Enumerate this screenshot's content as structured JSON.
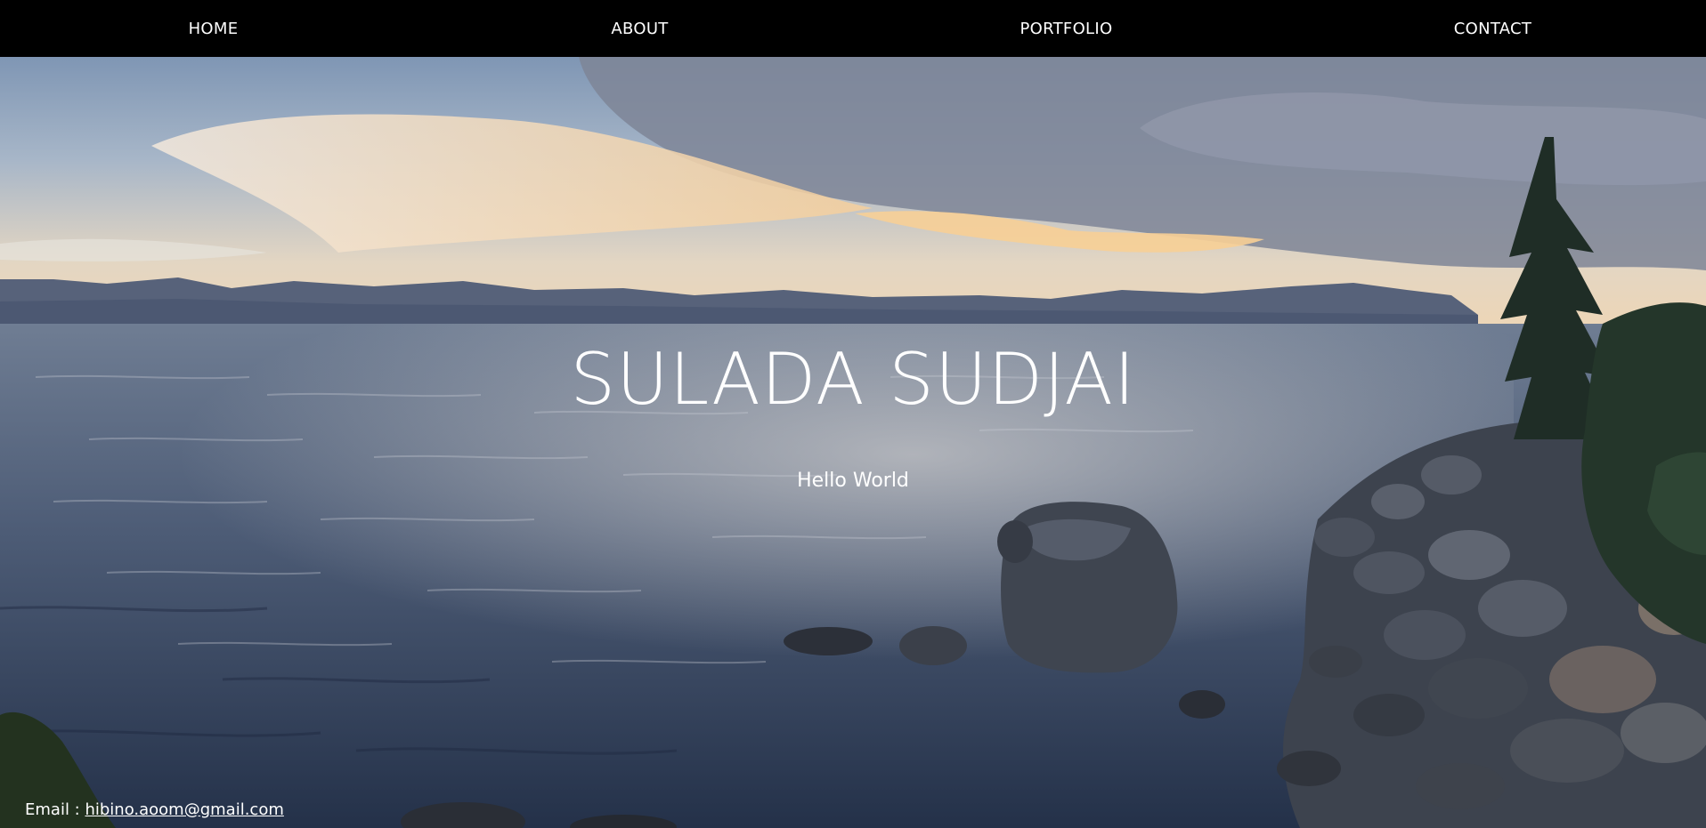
{
  "nav": {
    "items": [
      {
        "label": "HOME"
      },
      {
        "label": "ABOUT"
      },
      {
        "label": "PORTFOLIO"
      },
      {
        "label": "CONTACT"
      }
    ]
  },
  "hero": {
    "title": "SULADA SUDJAI",
    "subtitle": "Hello World",
    "background": "lake-sunset-rocky-shore-photo"
  },
  "footer": {
    "email_label": "Email :",
    "email": "hibino.aoom@gmail.com"
  },
  "colors": {
    "nav_bg": "#000000",
    "text": "#ffffff"
  }
}
